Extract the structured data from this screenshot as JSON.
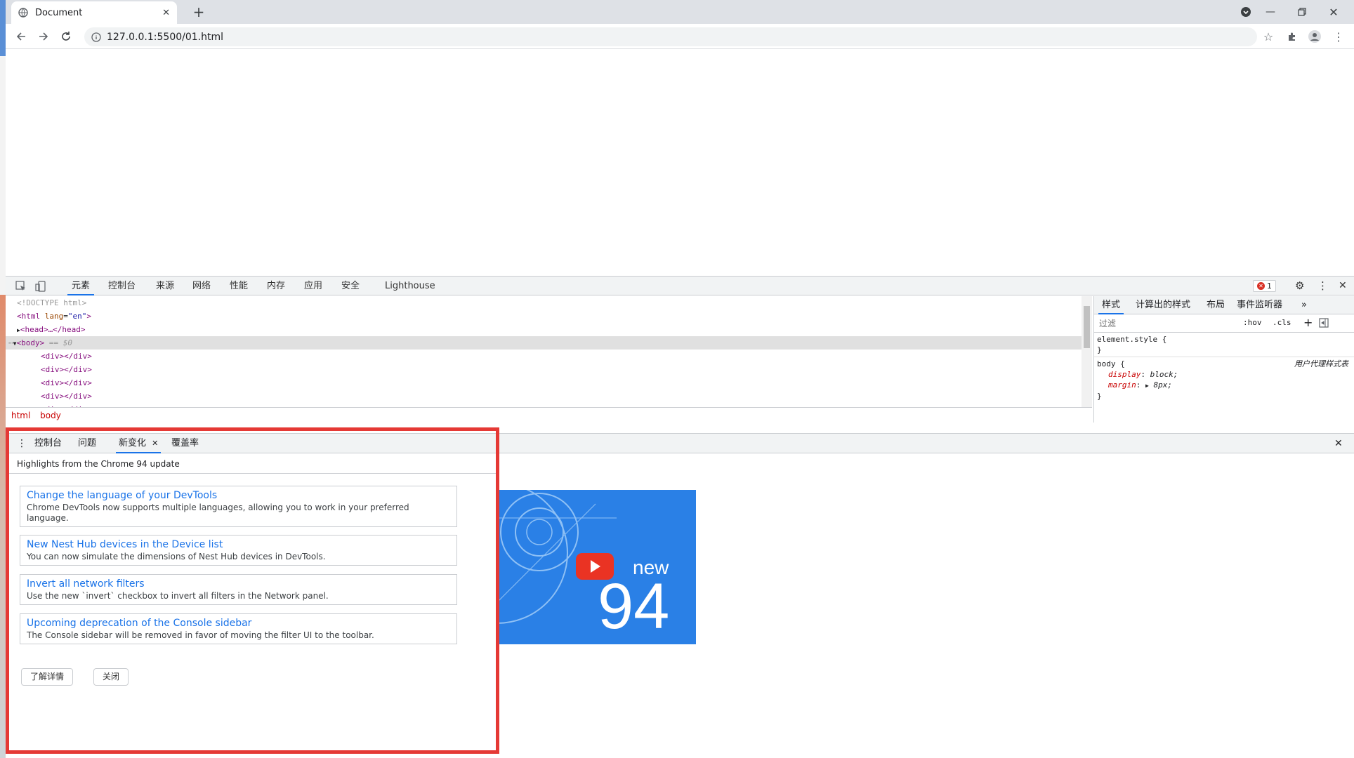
{
  "browser": {
    "tab_title": "Document",
    "url": "127.0.0.1:5500/01.html"
  },
  "devtools": {
    "tabs": [
      "元素",
      "控制台",
      "来源",
      "网络",
      "性能",
      "内存",
      "应用",
      "安全",
      "Lighthouse"
    ],
    "error_count": "1",
    "elements": {
      "doctype": "<!DOCTYPE html>",
      "html_open": "<html",
      "lang_attr": "lang",
      "lang_value": "\"en\"",
      "html_close": ">",
      "head": "<head>…</head>",
      "body_open": "<body>",
      "body_marker": "== $0",
      "div": "<div></div>"
    },
    "breadcrumb": [
      "html",
      "body"
    ],
    "styles": {
      "tabs": [
        "样式",
        "计算出的样式",
        "布局",
        "事件监听器"
      ],
      "more": "»",
      "filter_placeholder": "过滤",
      "hov": ":hov",
      "cls": ".cls",
      "element_style": "element.style {",
      "close_brace": "}",
      "body_selector": "body {",
      "user_agent": "用户代理样式表",
      "prop_display": "display",
      "val_display": "block;",
      "prop_margin": "margin",
      "val_margin": "8px;"
    }
  },
  "drawer": {
    "tabs": [
      "控制台",
      "问题",
      "新变化",
      "覆盖率"
    ],
    "header": "Highlights from the Chrome 94 update",
    "features": [
      {
        "title": "Change the language of your DevTools",
        "desc": "Chrome DevTools now supports multiple languages, allowing you to work in your preferred language."
      },
      {
        "title": "New Nest Hub devices in the Device list",
        "desc": "You can now simulate the dimensions of Nest Hub devices in DevTools."
      },
      {
        "title": "Invert all network filters",
        "desc": "Use the new `invert` checkbox to invert all filters in the Network panel."
      },
      {
        "title": "Upcoming deprecation of the Console sidebar",
        "desc": "The Console sidebar will be removed in favor of moving the filter UI to the toolbar."
      }
    ],
    "learn_more": "了解详情",
    "close": "关闭",
    "video": {
      "word": "new",
      "number": "94"
    }
  },
  "colors": {
    "accent": "#1a73e8",
    "annotation": "#e53935",
    "video_bg": "#2a80e6"
  }
}
